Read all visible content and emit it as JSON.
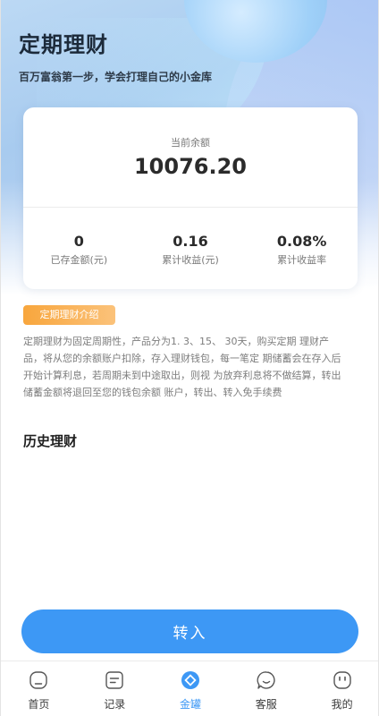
{
  "header": {
    "title": "定期理财",
    "subtitle": "百万富翁第一步，学会打理自己的小金库"
  },
  "balance_card": {
    "label": "当前余额",
    "value": "10076.20",
    "stats": [
      {
        "value": "0",
        "label": "已存金额(元)"
      },
      {
        "value": "0.16",
        "label": "累计收益(元)"
      },
      {
        "value": "0.08%",
        "label": "累计收益率"
      }
    ]
  },
  "intro": {
    "tag": "定期理财介绍",
    "text": "定期理财为固定周期性，产品分为1. 3、15、 30天，购买定期 理财产品，将从您的余额账户扣除，存入理财钱包，每一笔定 期储蓄会在存入后开始计算利息，若周期未到中途取出，则视 为放弃利息将不做结算，转出储蓄金额将退回至您的钱包余额 账户，转出、转入免手续费"
  },
  "history": {
    "title": "历史理财"
  },
  "actions": {
    "transfer_in": "转入"
  },
  "tabbar": {
    "items": [
      {
        "label": "首页",
        "icon": "home-icon"
      },
      {
        "label": "记录",
        "icon": "record-icon"
      },
      {
        "label": "金罐",
        "icon": "jar-icon"
      },
      {
        "label": "客服",
        "icon": "chat-icon"
      },
      {
        "label": "我的",
        "icon": "profile-icon"
      }
    ],
    "active_index": 2
  },
  "colors": {
    "accent": "#3d98f5",
    "tag": "#f8a63d",
    "title": "#1c2a3a"
  }
}
